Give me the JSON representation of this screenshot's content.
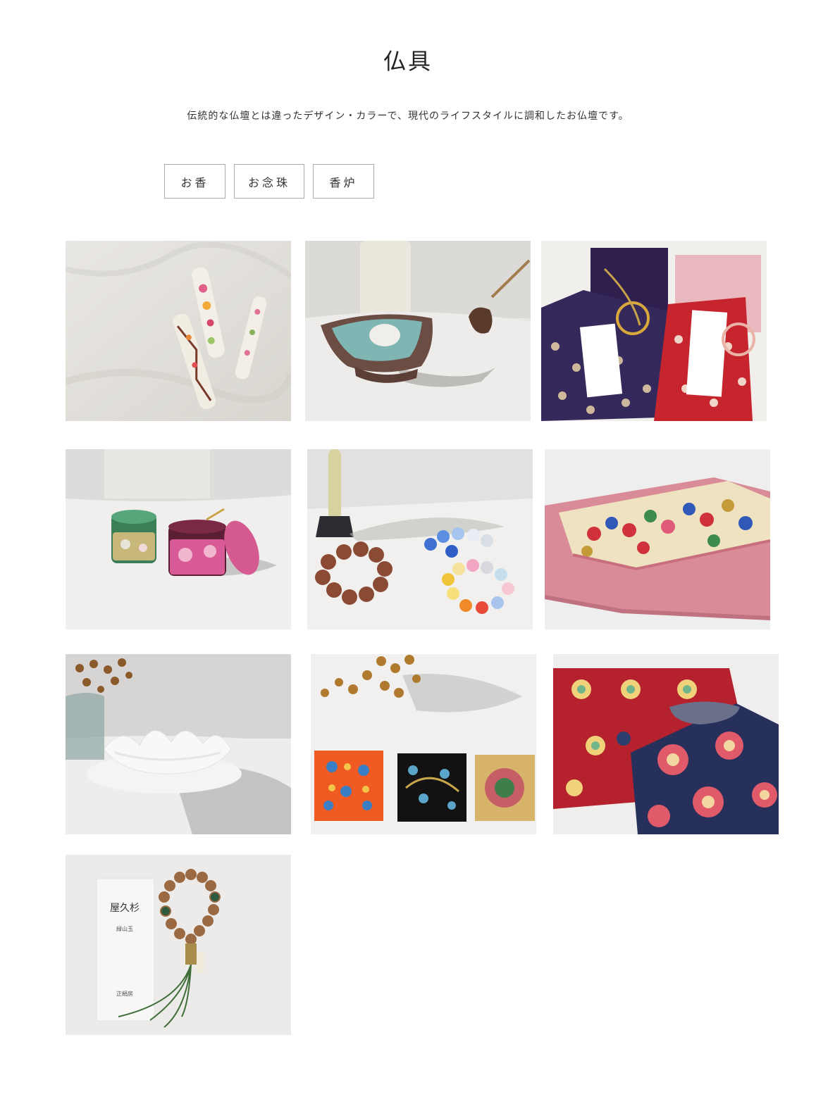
{
  "page": {
    "title": "仏具",
    "description": "伝統的な仏壇とは違ったデザイン・カラーで、現代のライフスタイルに調和したお仏壇です。"
  },
  "filters": [
    {
      "label": "お香"
    },
    {
      "label": "お念珠"
    },
    {
      "label": "香炉"
    }
  ],
  "products": [
    {
      "icon": "painted-candles-image"
    },
    {
      "icon": "incense-burner-dish-image"
    },
    {
      "icon": "gift-envelopes-image"
    },
    {
      "icon": "tea-caddies-image"
    },
    {
      "icon": "bead-bracelets-image"
    },
    {
      "icon": "brocade-pouch-image"
    },
    {
      "icon": "lotus-glass-bowl-image"
    },
    {
      "icon": "brocade-coasters-image"
    },
    {
      "icon": "brocade-purses-image"
    },
    {
      "icon": "yakusugi-rosary-image",
      "label_text": [
        "屋久杉",
        "緑山玉",
        "正絹房"
      ]
    }
  ],
  "colors": {
    "background": "#ffffff",
    "text": "#333333",
    "border": "#aaaaaa"
  }
}
